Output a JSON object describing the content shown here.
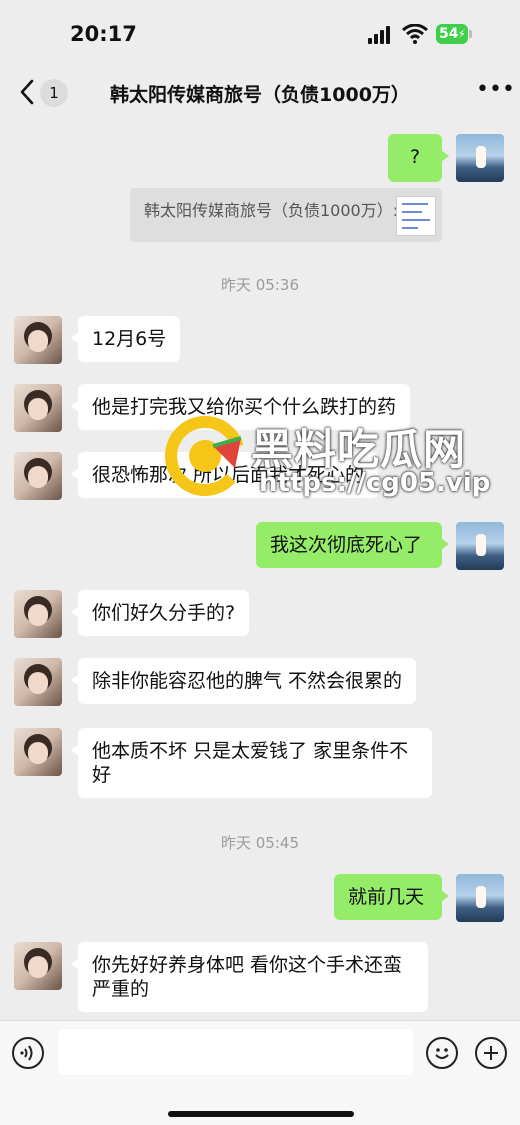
{
  "status_bar": {
    "time": "20:17",
    "battery": "54"
  },
  "header": {
    "back_badge": "1",
    "title": "韩太阳传媒商旅号（负债1000万）"
  },
  "quote": {
    "text": "韩太阳传媒商旅号（负债1000万）:"
  },
  "messages": [
    {
      "side": "out",
      "text": "?"
    },
    {
      "side": "in",
      "text": "12月6号"
    },
    {
      "side": "in",
      "text": "他是打完我又给你买个什么跌打的药"
    },
    {
      "side": "in",
      "text": "很恐怖那次 所以后面我才死心的"
    },
    {
      "side": "out",
      "text": "我这次彻底死心了"
    },
    {
      "side": "in",
      "text": "你们好久分手的?"
    },
    {
      "side": "in",
      "text": "除非你能容忍他的脾气 不然会很累的"
    },
    {
      "side": "in",
      "text": "他本质不坏 只是太爱钱了 家里条件不好"
    },
    {
      "side": "out",
      "text": "就前几天"
    },
    {
      "side": "in",
      "text": "你先好好养身体吧 看你这个手术还蛮严重的"
    }
  ],
  "timestamps": [
    "昨天 05:36",
    "昨天 05:45"
  ],
  "watermark": {
    "title": "黑料吃瓜网",
    "url": "https://cg05.vip"
  },
  "input": {
    "value": "",
    "placeholder": ""
  },
  "icons": {
    "accent_green": "#95ec69",
    "wm_yellow": "#f5c518"
  }
}
